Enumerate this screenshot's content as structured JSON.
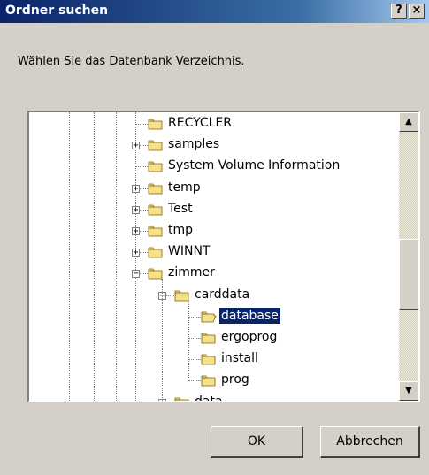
{
  "window": {
    "title": "Ordner suchen",
    "help_glyph": "?",
    "close_glyph": "×"
  },
  "prompt": "Wählen Sie das Datenbank Verzeichnis.",
  "tree": {
    "nodes": [
      {
        "label": "RECYCLER",
        "depth": 0,
        "expander": "",
        "selected": false,
        "icon": "folder-icon"
      },
      {
        "label": "samples",
        "depth": 0,
        "expander": "+",
        "selected": false,
        "icon": "folder-icon"
      },
      {
        "label": "System Volume Information",
        "depth": 0,
        "expander": "",
        "selected": false,
        "icon": "folder-icon"
      },
      {
        "label": "temp",
        "depth": 0,
        "expander": "+",
        "selected": false,
        "icon": "folder-icon"
      },
      {
        "label": "Test",
        "depth": 0,
        "expander": "+",
        "selected": false,
        "icon": "folder-icon"
      },
      {
        "label": "tmp",
        "depth": 0,
        "expander": "+",
        "selected": false,
        "icon": "folder-icon"
      },
      {
        "label": "WINNT",
        "depth": 0,
        "expander": "+",
        "selected": false,
        "icon": "folder-icon"
      },
      {
        "label": "zimmer",
        "depth": 0,
        "expander": "−",
        "selected": false,
        "icon": "folder-icon"
      },
      {
        "label": "carddata",
        "depth": 1,
        "expander": "−",
        "selected": false,
        "icon": "folder-icon"
      },
      {
        "label": "database",
        "depth": 2,
        "expander": "",
        "selected": true,
        "icon": "open-folder-icon"
      },
      {
        "label": "ergoprog",
        "depth": 2,
        "expander": "",
        "selected": false,
        "icon": "folder-icon"
      },
      {
        "label": "install",
        "depth": 2,
        "expander": "",
        "selected": false,
        "icon": "folder-icon"
      },
      {
        "label": "prog",
        "depth": 2,
        "expander": "",
        "selected": false,
        "icon": "folder-icon"
      },
      {
        "label": "data",
        "depth": 1,
        "expander": "+",
        "selected": false,
        "icon": "folder-icon"
      }
    ],
    "scroll_position": 0.6
  },
  "buttons": {
    "ok": "OK",
    "cancel": "Abbrechen"
  },
  "colors": {
    "title_start": "#0a246a",
    "title_end": "#a6caf0",
    "selection": "#0a246a",
    "folder": "#f5e08c"
  }
}
